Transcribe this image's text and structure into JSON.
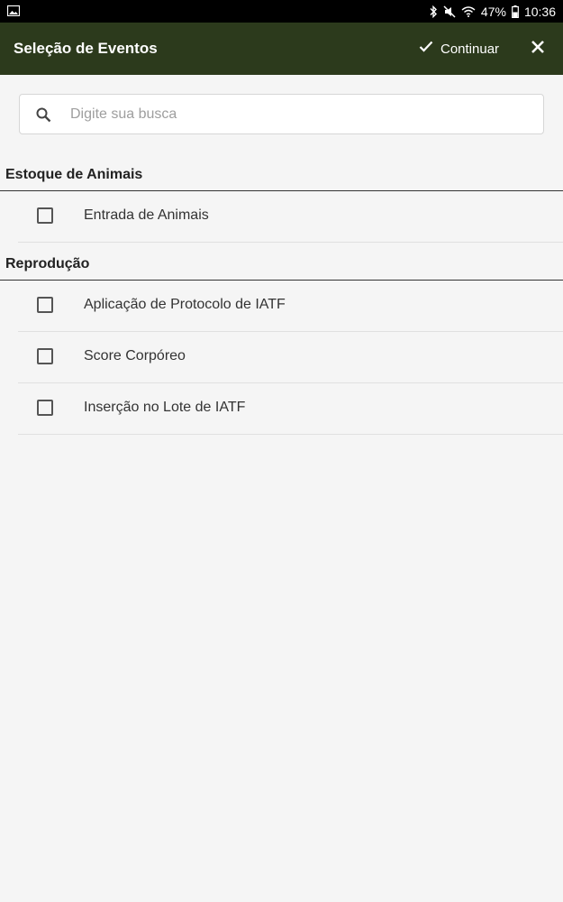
{
  "status_bar": {
    "battery": "47%",
    "time": "10:36",
    "icons": [
      "image-icon",
      "bluetooth-icon",
      "mute-icon",
      "wifi-icon",
      "battery-icon"
    ]
  },
  "app_bar": {
    "title": "Seleção de Eventos",
    "continue_label": "Continuar",
    "icons": [
      "check-icon",
      "close-icon"
    ],
    "color": "#2c3a1c"
  },
  "search": {
    "placeholder": "Digite sua busca",
    "value": ""
  },
  "sections": [
    {
      "title": "Estoque de Animais",
      "items": [
        {
          "label": "Entrada de Animais",
          "checked": false
        }
      ]
    },
    {
      "title": "Reprodução",
      "items": [
        {
          "label": "Aplicação de Protocolo de IATF",
          "checked": false
        },
        {
          "label": "Score Corpóreo",
          "checked": false
        },
        {
          "label": "Inserção no Lote de IATF",
          "checked": false
        }
      ]
    }
  ]
}
